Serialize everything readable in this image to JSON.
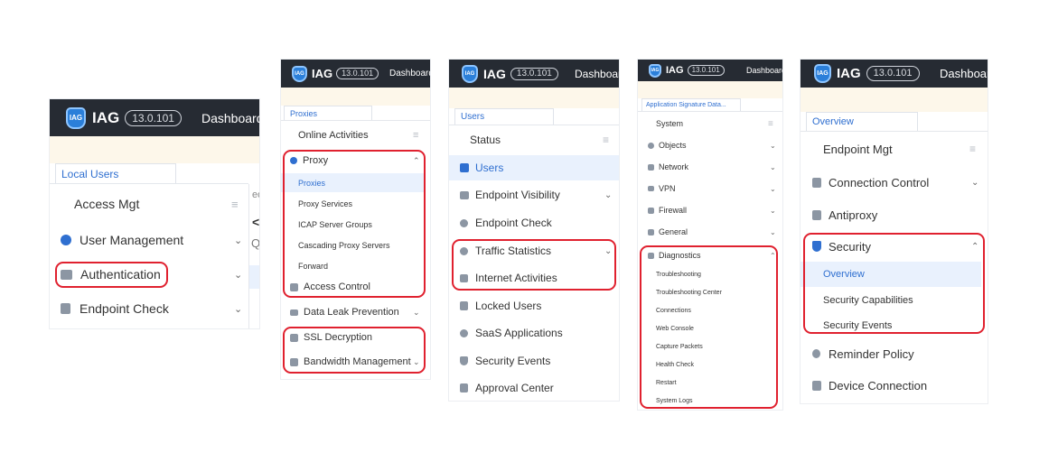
{
  "brand": "IAG",
  "logo_text": "IAG",
  "version": "13.0.101",
  "nav_link": "Dashboard",
  "colors": {
    "header_bg": "#262b33",
    "accent": "#2f6fd0",
    "highlight": "#e0212f",
    "selected_bg": "#e9f1fd",
    "band": "#fdf7ea"
  },
  "icons": {
    "list": "list-icon",
    "chevron_down": "chevron-down-icon",
    "chevron_up": "chevron-up-icon"
  },
  "panel1": {
    "tab": "Local Users",
    "items": [
      {
        "label": "Access Mgt"
      },
      {
        "label": "User Management",
        "icon": "user-icon"
      },
      {
        "label": "Authentication",
        "icon": "id-card-icon"
      },
      {
        "label": "Endpoint Check",
        "icon": "device-icon"
      }
    ],
    "cut_text": "ed",
    "cut_arrow": "<",
    "cut_search": "Q"
  },
  "panel2": {
    "tab": "Proxies",
    "items": [
      {
        "label": "Online Activities"
      },
      {
        "label": "Proxy",
        "icon": "globe-icon"
      },
      {
        "label": "Proxies"
      },
      {
        "label": "Proxy Services"
      },
      {
        "label": "ICAP Server Groups"
      },
      {
        "label": "Cascading Proxy Servers"
      },
      {
        "label": "Forward"
      },
      {
        "label": "Access Control",
        "icon": "shield-list-icon"
      },
      {
        "label": "Data Leak Prevention",
        "icon": "dlp-icon"
      },
      {
        "label": "SSL Decryption",
        "icon": "ssl-icon"
      },
      {
        "label": "Bandwidth Management",
        "icon": "bandwidth-icon"
      }
    ]
  },
  "panel3": {
    "tab": "Users",
    "items": [
      {
        "label": "Status"
      },
      {
        "label": "Users",
        "icon": "users-icon"
      },
      {
        "label": "Endpoint Visibility",
        "icon": "visibility-icon"
      },
      {
        "label": "Endpoint Check",
        "icon": "search-icon"
      },
      {
        "label": "Traffic Statistics",
        "icon": "traffic-icon"
      },
      {
        "label": "Internet Activities",
        "icon": "activity-icon"
      },
      {
        "label": "Locked Users",
        "icon": "lock-icon"
      },
      {
        "label": "SaaS Applications",
        "icon": "cloud-icon"
      },
      {
        "label": "Security Events",
        "icon": "shield-icon"
      },
      {
        "label": "Approval Center",
        "icon": "approval-icon"
      }
    ]
  },
  "panel4": {
    "tab": "Application Signature Data...",
    "items": [
      {
        "label": "System"
      },
      {
        "label": "Objects",
        "icon": "objects-icon"
      },
      {
        "label": "Network",
        "icon": "network-icon"
      },
      {
        "label": "VPN",
        "icon": "vpn-icon"
      },
      {
        "label": "Firewall",
        "icon": "firewall-icon"
      },
      {
        "label": "General",
        "icon": "general-icon"
      },
      {
        "label": "Diagnostics",
        "icon": "diagnostics-icon"
      },
      {
        "label": "Troubleshooting"
      },
      {
        "label": "Troubleshooting Center"
      },
      {
        "label": "Connections"
      },
      {
        "label": "Web Console"
      },
      {
        "label": "Capture Packets"
      },
      {
        "label": "Health Check"
      },
      {
        "label": "Restart"
      },
      {
        "label": "System Logs"
      }
    ]
  },
  "panel5": {
    "tab": "Overview",
    "items": [
      {
        "label": "Endpoint Mgt"
      },
      {
        "label": "Connection Control",
        "icon": "connection-icon"
      },
      {
        "label": "Antiproxy",
        "icon": "antiproxy-icon"
      },
      {
        "label": "Security",
        "icon": "security-shield-icon"
      },
      {
        "label": "Overview"
      },
      {
        "label": "Security Capabilities"
      },
      {
        "label": "Security Events"
      },
      {
        "label": "Reminder Policy",
        "icon": "bell-icon"
      },
      {
        "label": "Device Connection",
        "icon": "device-connection-icon"
      }
    ]
  }
}
